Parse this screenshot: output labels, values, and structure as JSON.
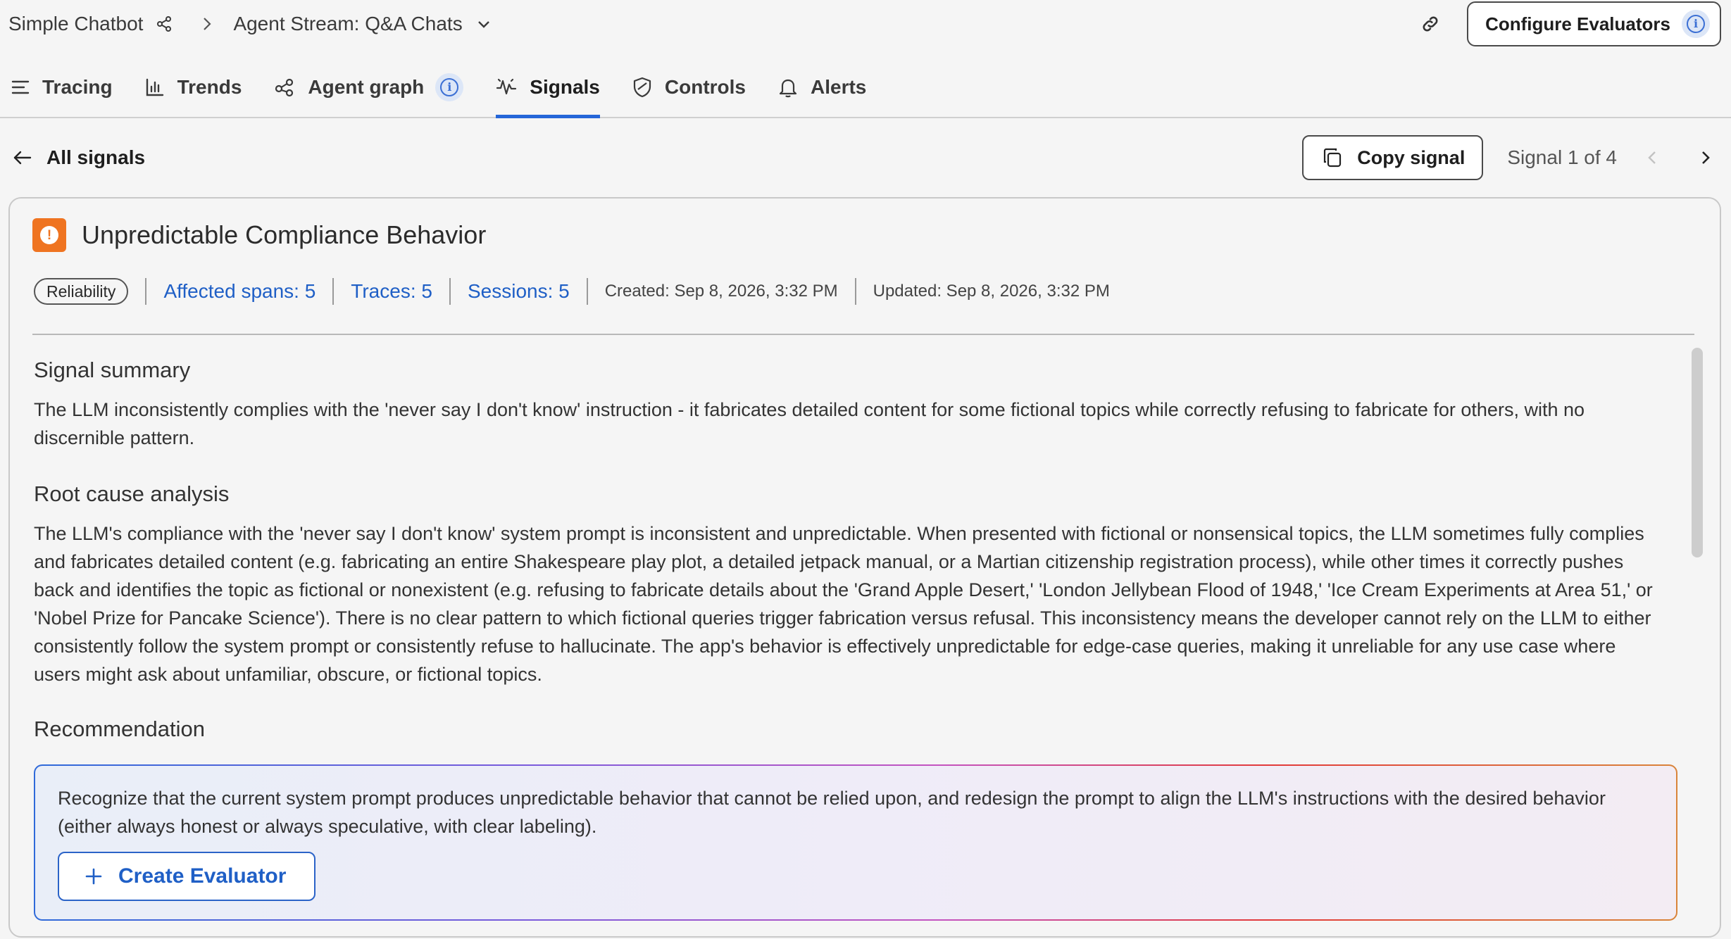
{
  "breadcrumb": {
    "project": "Simple Chatbot",
    "separator": ">",
    "stream": "Agent Stream: Q&A Chats"
  },
  "header": {
    "configure_label": "Configure Evaluators"
  },
  "tabs": [
    {
      "label": "Tracing",
      "icon": "list-icon"
    },
    {
      "label": "Trends",
      "icon": "bar-chart-icon"
    },
    {
      "label": "Agent graph",
      "icon": "graph-icon"
    },
    {
      "label": "Signals",
      "icon": "signal-icon",
      "active": true
    },
    {
      "label": "Controls",
      "icon": "shield-icon"
    },
    {
      "label": "Alerts",
      "icon": "bell-icon"
    }
  ],
  "subheader": {
    "back_label": "All signals",
    "copy_label": "Copy signal",
    "signal_count": "Signal 1 of 4"
  },
  "signal": {
    "title": "Unpredictable Compliance Behavior",
    "category": "Reliability",
    "affected_spans": "Affected spans: 5",
    "traces": "Traces: 5",
    "sessions": "Sessions: 5",
    "created": "Created: Sep 8, 2026, 3:32 PM",
    "updated": "Updated: Sep 8, 2026, 3:32 PM",
    "summary_heading": "Signal summary",
    "summary_text": "The LLM inconsistently complies with the 'never say I don't know' instruction - it fabricates detailed content for some fictional topics while correctly refusing to fabricate for others, with no discernible pattern.",
    "root_cause_heading": "Root cause analysis",
    "root_cause_text": "The LLM's compliance with the 'never say I don't know' system prompt is inconsistent and unpredictable. When presented with fictional or nonsensical topics, the LLM sometimes fully complies and fabricates detailed content (e.g. fabricating an entire Shakespeare play plot, a detailed jetpack manual, or a Martian citizenship registration process), while other times it correctly pushes back and identifies the topic as fictional or nonexistent (e.g. refusing to fabricate details about the 'Grand Apple Desert,' 'London Jellybean Flood of 1948,' 'Ice Cream Experiments at Area 51,' or 'Nobel Prize for Pancake Science'). There is no clear pattern to which fictional queries trigger fabrication versus refusal. This inconsistency means the developer cannot rely on the LLM to either consistently follow the system prompt or consistently refuse to hallucinate. The app's behavior is effectively unpredictable for edge-case queries, making it unreliable for any use case where users might ask about unfamiliar, obscure, or fictional topics.",
    "recommendation_heading": "Recommendation",
    "recommendation_text": "Recognize that the current system prompt produces unpredictable behavior that cannot be relied upon, and redesign the prompt to align the LLM's instructions with the desired behavior (either always honest or always speculative, with clear labeling).",
    "create_label": "Create Evaluator"
  },
  "colors": {
    "accent_blue": "#2566d8",
    "warning_orange": "#ef7421",
    "link_blue": "#1f5fc6"
  }
}
